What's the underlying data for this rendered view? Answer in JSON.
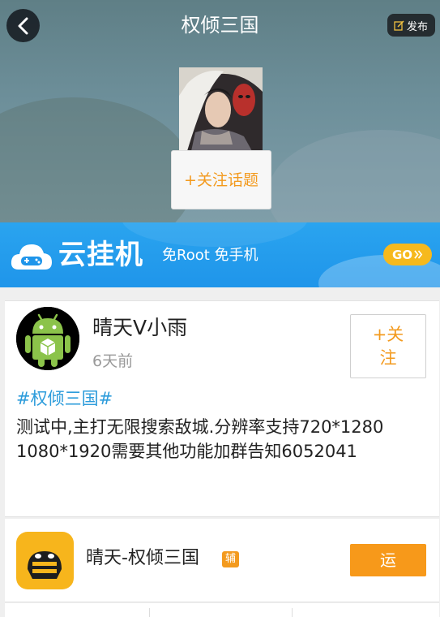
{
  "header": {
    "title": "权倾三国",
    "back_icon": "back-arrow-icon",
    "publish_label": "发布",
    "publish_icon": "edit-icon",
    "follow_topic_label": "+关注话题"
  },
  "banner": {
    "title": "云挂机",
    "subtitle": "免Root 免手机",
    "go_label": "GO",
    "go_icon": "double-chevron-right-icon",
    "logo_icon": "cloud-gamepad-icon"
  },
  "post": {
    "user_name": "晴天V小雨",
    "time": "6天前",
    "follow_label": "+关注",
    "topic_tag": "#权倾三国#",
    "body": "测试中,主打无限搜索敌城.分辨率支持720*1280  1080*1920需要其他功能加群告知6052041"
  },
  "app": {
    "name": "晴天-权倾三国",
    "badge": "辅",
    "run_label": "运"
  },
  "colors": {
    "accent_orange": "#f39a1e",
    "link_blue": "#2d9cdb",
    "banner_blue": "#1f95ea",
    "go_yellow": "#f6b91d"
  }
}
